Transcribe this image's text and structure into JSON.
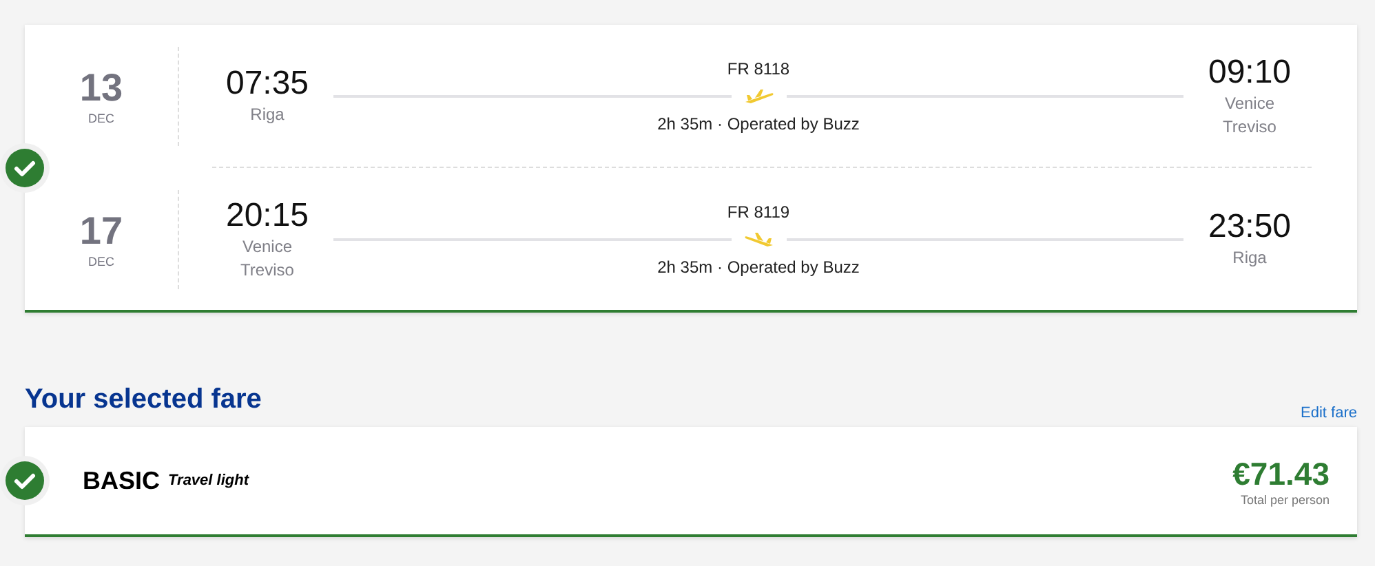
{
  "flights_card": {
    "confirmed": true,
    "flights": [
      {
        "day": "13",
        "month": "DEC",
        "depart_time": "07:35",
        "depart_city": [
          "Riga"
        ],
        "flight_number": "FR 8118",
        "kind": "outbound",
        "info": "2h 35m · Operated by Buzz",
        "arrive_time": "09:10",
        "arrive_city": [
          "Venice",
          "Treviso"
        ]
      },
      {
        "day": "17",
        "month": "DEC",
        "depart_time": "20:15",
        "depart_city": [
          "Venice",
          "Treviso"
        ],
        "flight_number": "FR 8119",
        "kind": "return",
        "info": "2h 35m · Operated by Buzz",
        "arrive_time": "23:50",
        "arrive_city": [
          "Riga"
        ]
      }
    ]
  },
  "fare_section": {
    "title": "Your selected fare",
    "edit_link": "Edit fare",
    "fare": {
      "confirmed": true,
      "name": "BASIC",
      "tagline": "Travel light",
      "price": "€71.43",
      "price_note": "Total per person"
    }
  }
}
